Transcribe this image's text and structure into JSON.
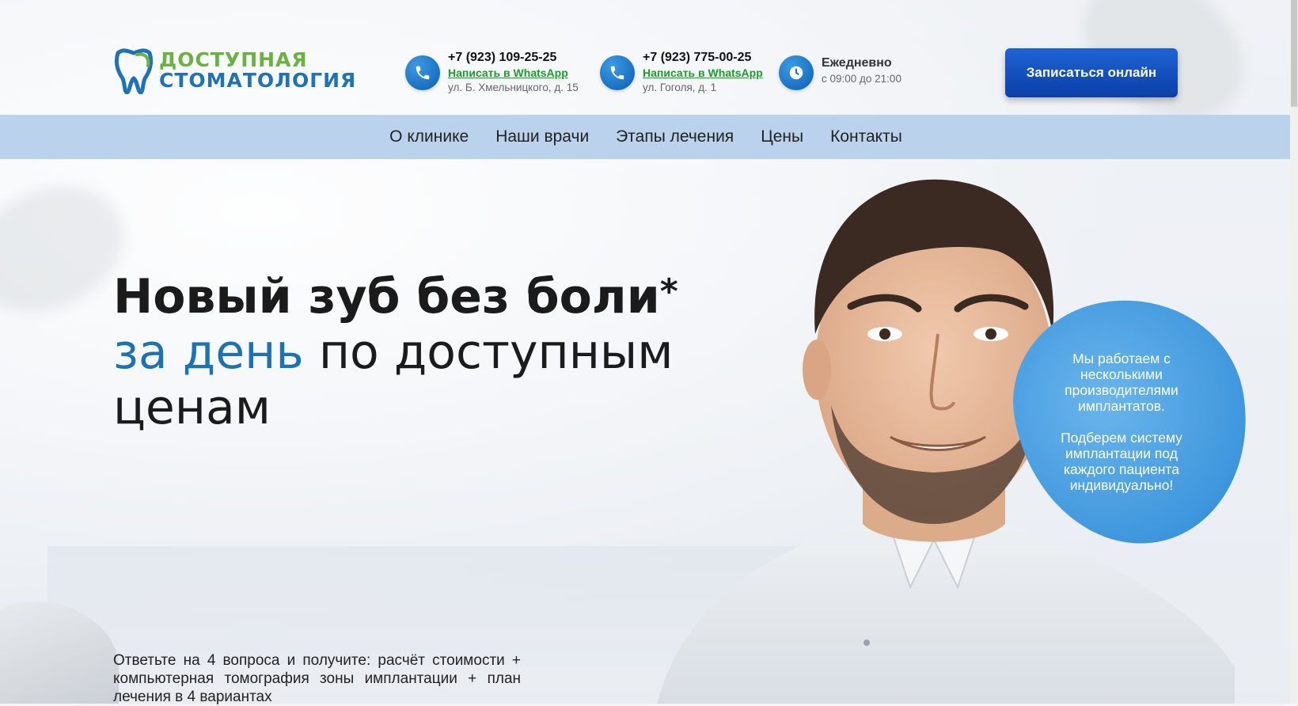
{
  "header": {
    "logo": {
      "line1": "ДОСТУПНАЯ",
      "line2": "СТОМАТОЛОГИЯ"
    },
    "contacts": [
      {
        "phone": "+7 (923) 109-25-25",
        "whatsapp": "Написать в WhatsApp",
        "address": "ул. Б. Хмельницкого, д. 15"
      },
      {
        "phone": "+7 (923) 775-00-25",
        "whatsapp": "Написать в WhatsApp",
        "address": "ул. Гоголя, д. 1"
      }
    ],
    "hours": {
      "title": "Ежедневно",
      "time": "с 09:00 до 21:00"
    },
    "cta_label": "Записаться онлайн"
  },
  "nav": {
    "items": [
      "О клинике",
      "Наши врачи",
      "Этапы лечения",
      "Цены",
      "Контакты"
    ]
  },
  "hero": {
    "title_bold": "Новый зуб без боли",
    "title_star": "*",
    "title_blue": "за день",
    "title_rest1": "по доступным",
    "title_rest2": "ценам",
    "subtitle": "Ответьте на 4 вопроса и получите: расчёт стоимости + компьютерная томография зоны имплантации + план лечения в 4 вариантах"
  },
  "blob": {
    "p1": "Мы работаем с несколькими производителями имплантатов.",
    "p2": "Подберем систему имплантации под каждого пациента индивидуально!"
  },
  "colors": {
    "brand_green": "#6ab243",
    "brand_blue": "#1f72b8",
    "nav_bg": "#bad2ec",
    "cta_blue": "#1549c0",
    "whatsapp_green": "#1a9e2a"
  },
  "icons": {
    "phone": "phone-icon",
    "clock": "clock-icon",
    "logo": "tooth-icon"
  }
}
